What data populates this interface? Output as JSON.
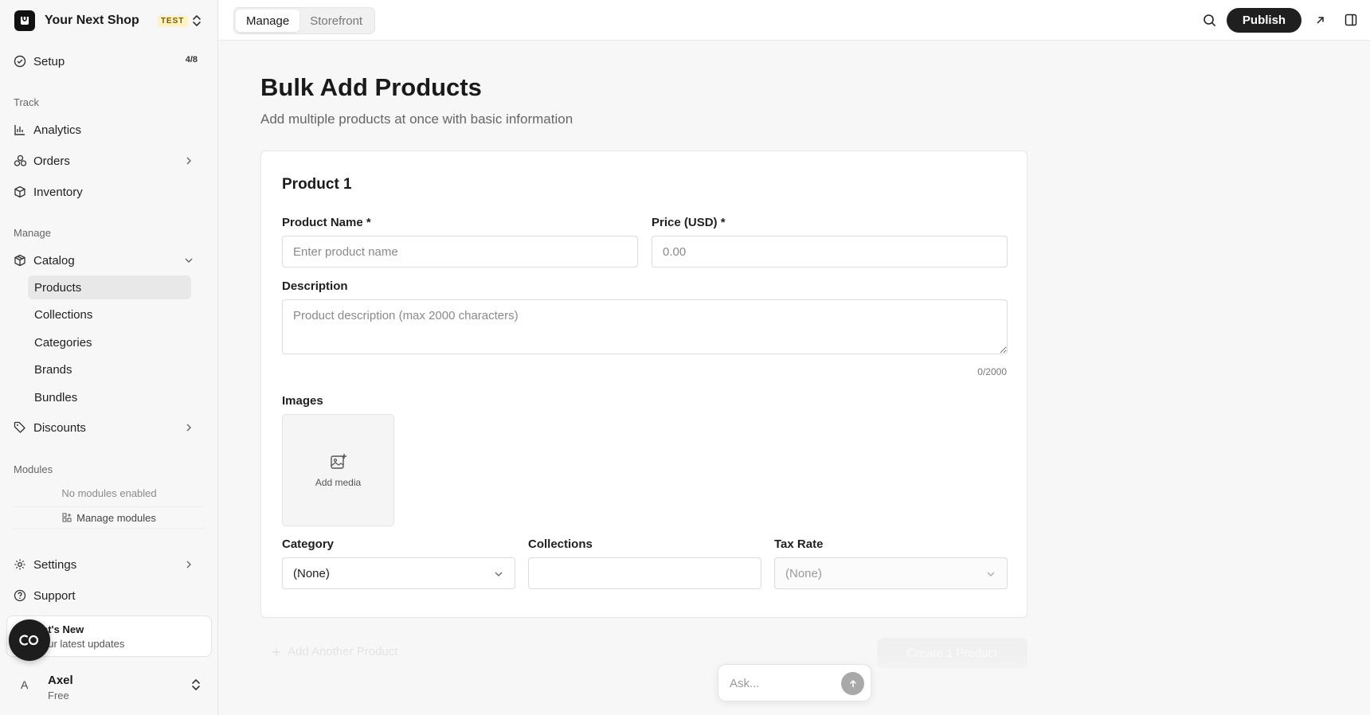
{
  "brand": {
    "name": "Your Next Shop",
    "badge": "TEST"
  },
  "sidebar": {
    "setup": {
      "label": "Setup",
      "progress": "4/8"
    },
    "track_label": "Track",
    "track_items": [
      {
        "label": "Analytics",
        "icon": "bar-chart-icon"
      },
      {
        "label": "Orders",
        "icon": "orders-icon"
      },
      {
        "label": "Inventory",
        "icon": "box-icon"
      }
    ],
    "manage_label": "Manage",
    "catalog": {
      "label": "Catalog",
      "subitems": [
        "Products",
        "Collections",
        "Categories",
        "Brands",
        "Bundles"
      ],
      "active": "Products"
    },
    "discounts": {
      "label": "Discounts"
    },
    "modules_label": "Modules",
    "modules_empty": "No modules enabled",
    "manage_modules": "Manage modules",
    "settings": {
      "label": "Settings"
    },
    "support": {
      "label": "Support"
    },
    "whats_new": {
      "title": "at's New",
      "subtitle": "our latest updates"
    },
    "user": {
      "initial": "A",
      "name": "Axel",
      "plan": "Free"
    }
  },
  "topbar": {
    "tabs": [
      "Manage",
      "Storefront"
    ],
    "active_tab": "Manage",
    "publish_label": "Publish"
  },
  "page": {
    "title": "Bulk Add Products",
    "subtitle": "Add multiple products at once with basic information"
  },
  "form": {
    "card_title": "Product 1",
    "product_name_label": "Product Name *",
    "product_name_placeholder": "Enter product name",
    "product_name_value": "",
    "price_label": "Price (USD) *",
    "price_placeholder": "0.00",
    "price_value": "",
    "description_label": "Description",
    "description_placeholder": "Product description (max 2000 characters)",
    "description_counter": "0/2000",
    "images_label": "Images",
    "add_media": "Add media",
    "category_label": "Category",
    "category_value": "(None)",
    "collections_label": "Collections",
    "collections_value": "",
    "tax_rate_label": "Tax Rate",
    "tax_rate_value": "(None)"
  },
  "actions": {
    "add_another": "Add Another Product",
    "create": "Create 1 Product"
  },
  "ask": {
    "placeholder": "Ask..."
  },
  "colors": {
    "primary": "#1f1f1f",
    "badge_bg": "#fdf3c7",
    "active_bg": "#e8e8e8"
  }
}
